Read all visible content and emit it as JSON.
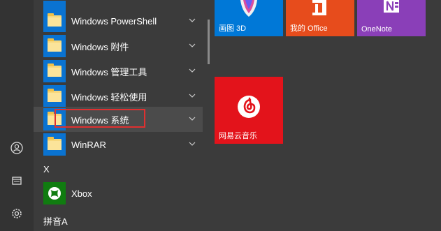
{
  "app_list": {
    "items": [
      {
        "label": "Windows PowerShell"
      },
      {
        "label": "Windows 附件"
      },
      {
        "label": "Windows 管理工具"
      },
      {
        "label": "Windows 轻松使用"
      },
      {
        "label": "Windows 系统"
      },
      {
        "label": "WinRAR"
      }
    ],
    "section_x": "X",
    "xbox_label": "Xbox",
    "section_pinyin_a": "拼音A"
  },
  "tiles": {
    "paint3d": {
      "label": "画图 3D",
      "color": "#0078d7"
    },
    "office": {
      "label": "我的 Office",
      "color": "#e74c1c"
    },
    "onenote": {
      "label": "OneNote",
      "color": "#8a3fb8"
    },
    "netease": {
      "label": "网易云音乐",
      "color": "#e3131b"
    }
  },
  "colors": {
    "background": "#3b3b3b",
    "rail": "#333333",
    "highlight_row": "#4b4b4b",
    "folder_tile": "#0a73d1",
    "xbox_tile": "#107c10",
    "annotation_box": "#e03030"
  },
  "icons": {
    "rail": [
      "user-icon",
      "documents-icon",
      "settings-icon"
    ]
  }
}
